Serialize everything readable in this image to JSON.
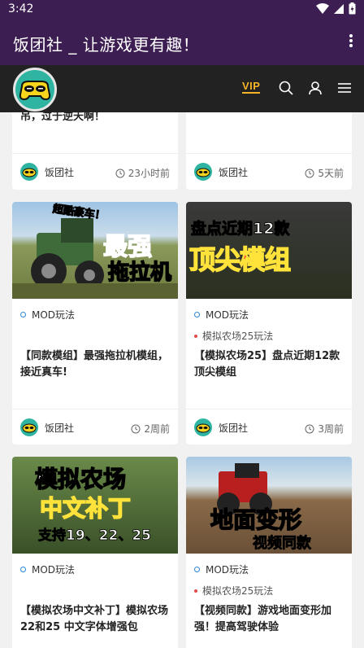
{
  "status_bar": {
    "time": "3:42"
  },
  "app_bar": {
    "title": "饭团社 _ 让游戏更有趣！"
  },
  "header": {
    "vip_label": "VIP"
  },
  "cards": [
    {
      "title": "吊，过于逆天啊！",
      "author": "饭团社",
      "time": "23小时前"
    },
    {
      "title": "",
      "author": "饭团社",
      "time": "5天前"
    },
    {
      "thumb_top": "超酷豪车！",
      "thumb_main": "最强",
      "thumb_sub": "拖拉机",
      "tag": "MOD玩法",
      "title": "【同款模组】最强拖拉机模组，接近真车!",
      "author": "饭团社",
      "time": "2周前"
    },
    {
      "thumb_top": "盘点近期12款",
      "thumb_main": "顶尖模组",
      "tag": "MOD玩法",
      "subtag": "模拟农场25玩法",
      "title": "【模拟农场25】盘点近期12款顶尖模组",
      "author": "饭团社",
      "time": "3周前"
    },
    {
      "thumb_top": "模拟农场",
      "thumb_main": "中文补丁",
      "thumb_sub": "支持19、22、25",
      "tag": "MOD玩法",
      "title": "【模拟农场中文补丁】模拟农场22和25 中文字体增强包"
    },
    {
      "thumb_main": "地面变形",
      "thumb_sub": "视频同款",
      "tag": "MOD玩法",
      "subtag": "模拟农场25玩法",
      "title": "【视频同款】游戏地面变形加强！提高驾驶体验"
    }
  ]
}
